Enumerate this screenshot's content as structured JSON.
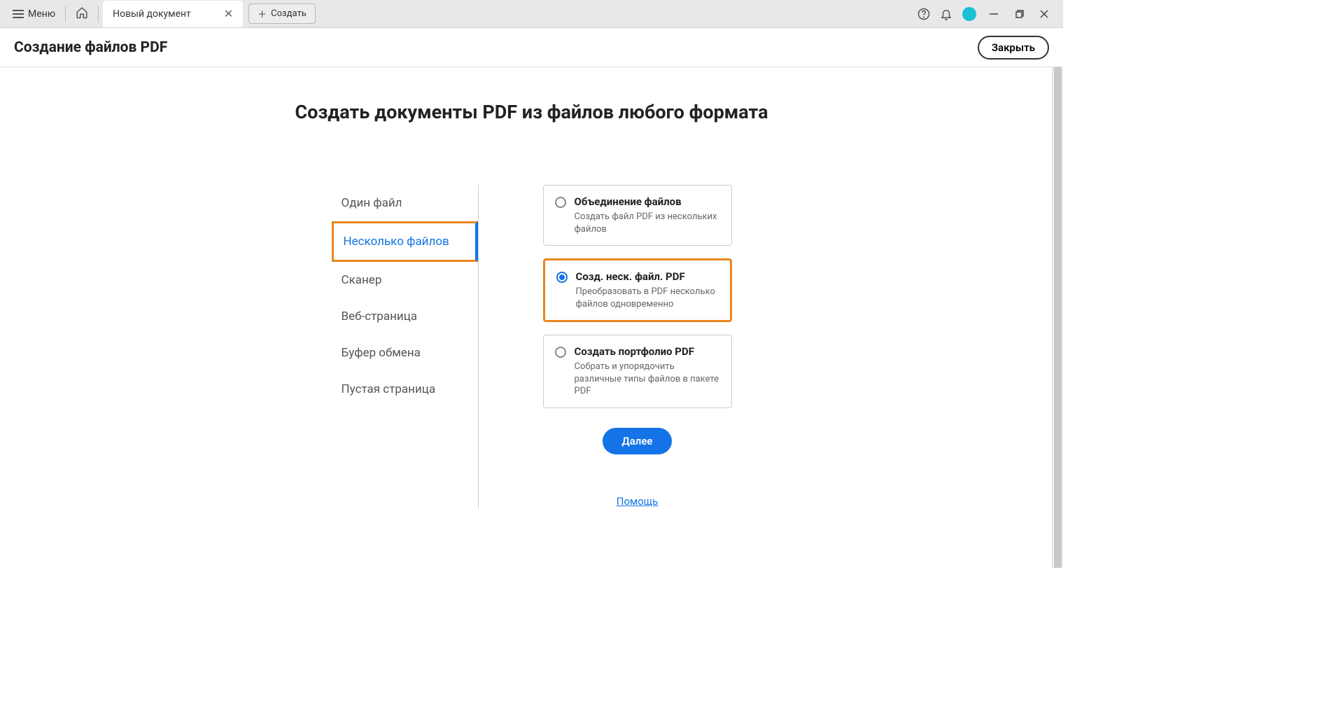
{
  "titlebar": {
    "menu_label": "Меню",
    "tab_title": "Новый документ",
    "create_label": "Создать"
  },
  "subheader": {
    "title": "Создание файлов PDF",
    "close_label": "Закрыть"
  },
  "main": {
    "heading": "Создать документы PDF из файлов любого формата",
    "sidebar": [
      {
        "label": "Один файл"
      },
      {
        "label": "Несколько файлов"
      },
      {
        "label": "Сканер"
      },
      {
        "label": "Веб-страница"
      },
      {
        "label": "Буфер обмена"
      },
      {
        "label": "Пустая страница"
      }
    ],
    "options": [
      {
        "title": "Объединение файлов",
        "desc": "Создать файл PDF из нескольких файлов"
      },
      {
        "title": "Созд. неск. файл. PDF",
        "desc": "Преобразовать в PDF несколько файлов одновременно"
      },
      {
        "title": "Создать портфолио PDF",
        "desc": "Собрать и упорядочить различные типы файлов в пакете PDF"
      }
    ],
    "next_label": "Далее",
    "help_label": "Помощь"
  }
}
